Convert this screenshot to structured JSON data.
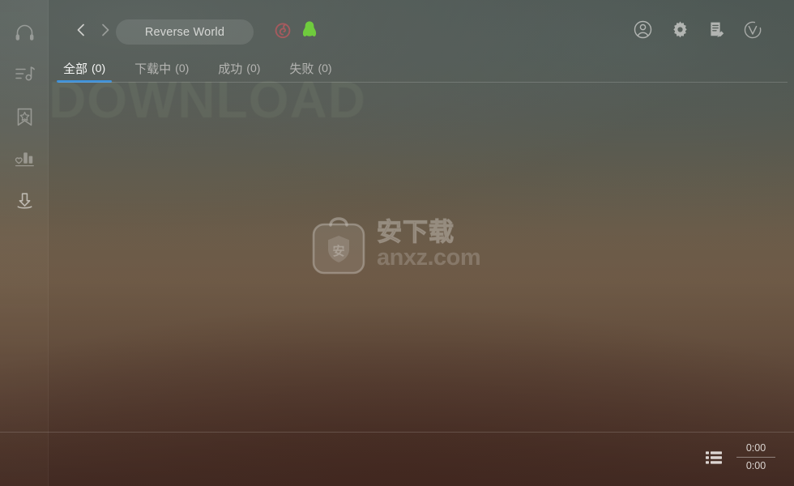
{
  "window": {
    "title": "Reverse World",
    "ghost_word": "DOWNLOAD"
  },
  "theme": {
    "accent": "#3d8fd6",
    "bg_top": "#4f5854",
    "bg_bottom": "#4a3028",
    "netease_red": "#a65a5e",
    "qq_green": "#6fcb3d",
    "text_primary": "#f2f0ee",
    "text_muted": "#b9b6b2"
  },
  "sidebar": {
    "items": [
      {
        "icon": "headphones-icon",
        "label": "发现音乐",
        "active": false
      },
      {
        "icon": "music-list-icon",
        "label": "我的歌单",
        "active": false
      },
      {
        "icon": "bookmark-star-icon",
        "label": "收藏",
        "active": false
      },
      {
        "icon": "bar-chart-icon",
        "label": "排行榜",
        "active": false
      },
      {
        "icon": "download-icon",
        "label": "下载管理",
        "active": true
      }
    ]
  },
  "topbar": {
    "back_icon": "chevron-left-icon",
    "forward_icon": "chevron-right-icon",
    "pill_label": "Reverse World",
    "services": [
      {
        "icon": "netease-music-icon",
        "label": "网易云音乐"
      },
      {
        "icon": "qq-music-icon",
        "label": "QQ音乐"
      }
    ],
    "tools": [
      {
        "icon": "user-circle-icon",
        "label": "个人中心"
      },
      {
        "icon": "gear-icon",
        "label": "设置"
      },
      {
        "icon": "note-edit-icon",
        "label": "意见反馈"
      },
      {
        "icon": "v-logo-icon",
        "label": "关于"
      }
    ]
  },
  "tabs": [
    {
      "label": "全部",
      "count": "(0)",
      "active": true
    },
    {
      "label": "下载中",
      "count": "(0)",
      "active": false
    },
    {
      "label": "成功",
      "count": "(0)",
      "active": false
    },
    {
      "label": "失败",
      "count": "(0)",
      "active": false
    }
  ],
  "download_list": {
    "rows": [],
    "empty": true
  },
  "watermark": {
    "icon": "anxz-bag-icon",
    "shield_char": "安",
    "cn_text": "安下载",
    "domain_text": "anxz.com"
  },
  "player": {
    "queue_icon": "queue-list-icon",
    "time_current": "0:00",
    "time_total": "0:00"
  }
}
